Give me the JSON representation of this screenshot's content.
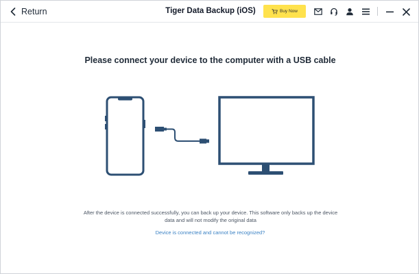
{
  "header": {
    "return_label": "Return",
    "title": "Tiger Data Backup (iOS)",
    "buy_label": "Buy Now",
    "icons": [
      "mail-icon",
      "headset-icon",
      "user-icon",
      "menu-icon",
      "minimize-icon",
      "close-icon"
    ]
  },
  "main": {
    "headline": "Please connect your device to the computer with a USB cable",
    "info_text": "After the device is connected successfully, you can back up your device. This software only backs up the device data and will not modify the original data",
    "help_link": "Device is connected and cannot be recognized?"
  },
  "colors": {
    "accent_yellow": "#ffe24d",
    "illustration_blue": "#2d4f73",
    "link_blue": "#3b82c4"
  }
}
